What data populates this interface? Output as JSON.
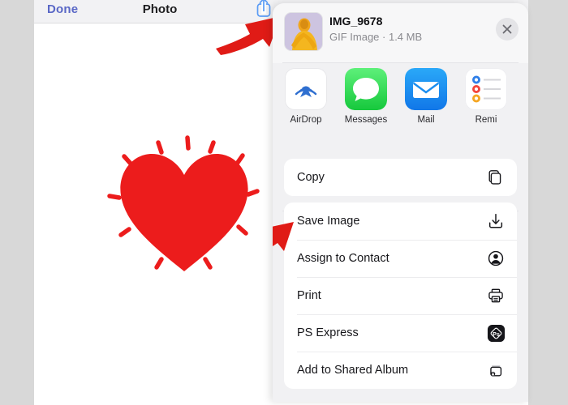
{
  "theme": {
    "page_background": "#d8d8d8",
    "panel_background": "#ffffff",
    "sheet_background": "#f1f1f3",
    "card_background": "#ffffff",
    "accent_blue": "#5a68c6",
    "annotation_red": "#e01b16",
    "heart_red": "#ec1c1c",
    "text_primary": "#16161a",
    "text_secondary": "#8a8a8f"
  },
  "photo_app": {
    "navbar": {
      "done_label": "Done",
      "title": "Photo",
      "share_icon": "share-up-arrow-icon"
    },
    "artwork": {
      "name": "red-heart-illustration",
      "color": "#ec1c1c",
      "sparkle_count": 10
    }
  },
  "share_sheet": {
    "header": {
      "thumbnail_icon": "person-in-yellow-hoodie-thumbnail",
      "file_name": "IMG_9678",
      "file_meta": "GIF Image · 1.4 MB",
      "close_icon": "close-icon"
    },
    "apps": [
      {
        "label": "AirDrop",
        "icon": "airdrop-icon",
        "color": "#ffffff"
      },
      {
        "label": "Messages",
        "icon": "messages-icon",
        "color": "#4cd964"
      },
      {
        "label": "Mail",
        "icon": "mail-icon",
        "color": "#1e9cf5"
      },
      {
        "label": "Remi",
        "icon": "reminders-icon",
        "color": "#ffffff"
      }
    ],
    "card_copy": [
      {
        "label": "Copy",
        "icon": "copy-documents-icon"
      }
    ],
    "card_actions": [
      {
        "label": "Save Image",
        "icon": "save-download-icon"
      },
      {
        "label": "Assign to Contact",
        "icon": "contact-person-icon"
      },
      {
        "label": "Print",
        "icon": "printer-icon"
      },
      {
        "label": "PS Express",
        "icon": "ps-express-icon"
      },
      {
        "label": "Add to Shared Album",
        "icon": "shared-album-icon"
      }
    ]
  },
  "annotations": [
    {
      "name": "arrow-to-share-button",
      "points_to": "share-up-arrow-icon",
      "direction": "up-right",
      "color": "#e01b16"
    },
    {
      "name": "arrow-to-save-image",
      "points_to": "Save Image",
      "direction": "up-right",
      "color": "#e01b16"
    }
  ]
}
